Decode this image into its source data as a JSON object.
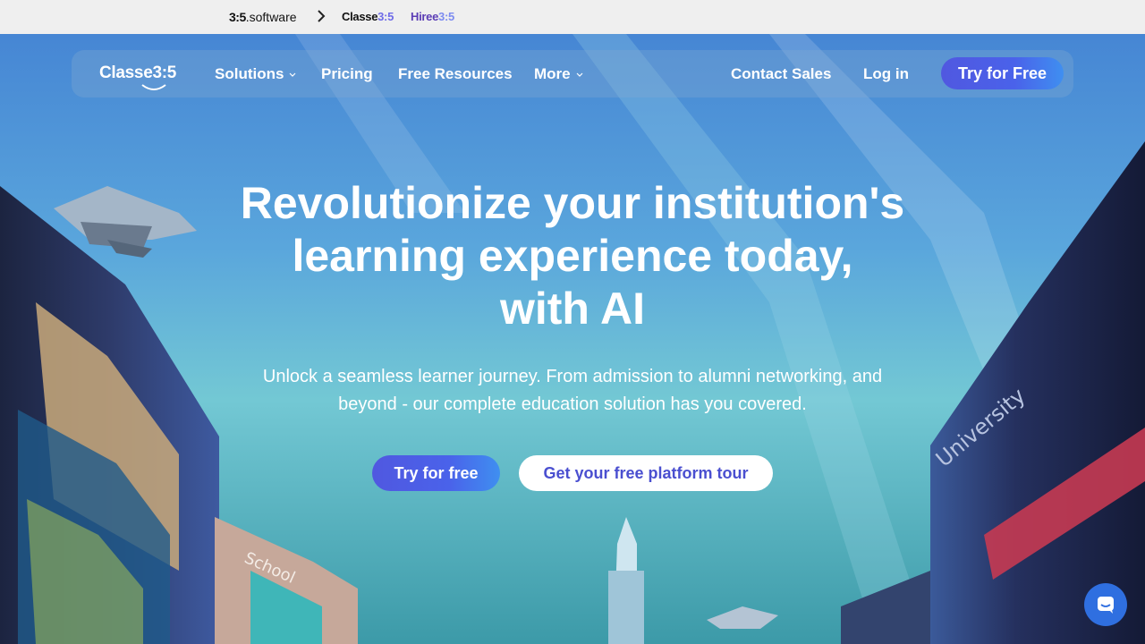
{
  "brandbar": {
    "software_prefix": "3:5",
    "software_suffix": ".software",
    "classe_small": "Classe",
    "classe_small_accent": "3:5",
    "hiree_small": "Hiree",
    "hiree_small_accent": "3:5"
  },
  "nav": {
    "logo_text": "Classe3:5",
    "items": [
      {
        "label": "Solutions",
        "has_caret": true
      },
      {
        "label": "Pricing",
        "has_caret": false
      },
      {
        "label": "Free Resources",
        "has_caret": false
      },
      {
        "label": "More",
        "has_caret": true
      }
    ],
    "contact_sales": "Contact Sales",
    "login": "Log in",
    "try_button": "Try for Free"
  },
  "hero": {
    "headline_line1": "Revolutionize your institution's",
    "headline_line2": "learning experience today,",
    "headline_line3": "with AI",
    "subtitle_line1": "Unlock a seamless learner journey. From admission to alumni networking, and",
    "subtitle_line2": "beyond - our complete education solution has you covered.",
    "cta_primary": "Try for free",
    "cta_secondary": "Get your free platform tour",
    "sign_school": "School",
    "sign_university": "University"
  },
  "icons": {
    "chevron": "chevron-right-icon",
    "caret": "chevron-down-icon",
    "chat": "chat-bubble-icon"
  },
  "colors": {
    "primary": "#4a5ae6",
    "secondary_text": "#4a4fd0",
    "chat": "#2f6fe0"
  }
}
